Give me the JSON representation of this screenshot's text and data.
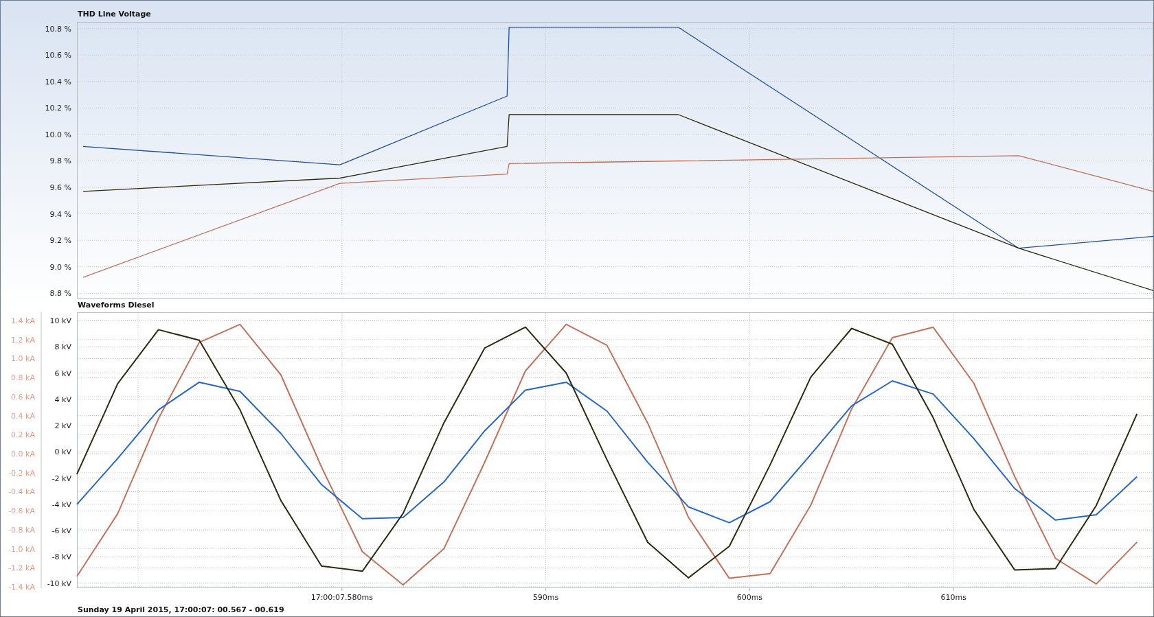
{
  "charts": [
    {
      "chart_data": {
        "type": "line",
        "title": "THD Line Voltage",
        "x": [
          567.3,
          579.9,
          588.1,
          588.2,
          596.5,
          613.2,
          619.8
        ],
        "xlim": [
          567,
          619.8
        ],
        "ylim": [
          8.76,
          10.85
        ],
        "grid": true,
        "yticks": [
          {
            "value": 10.8,
            "label": "10.8 %"
          },
          {
            "value": 10.6,
            "label": "10.6 %"
          },
          {
            "value": 10.4,
            "label": "10.4 %"
          },
          {
            "value": 10.2,
            "label": "10.2 %"
          },
          {
            "value": 10.0,
            "label": "10.0 %"
          },
          {
            "value": 9.8,
            "label": "9.8 %"
          },
          {
            "value": 9.6,
            "label": "9.6 %"
          },
          {
            "value": 9.4,
            "label": "9.4 %"
          },
          {
            "value": 9.2,
            "label": "9.2 %"
          },
          {
            "value": 9.0,
            "label": "9.0 %"
          },
          {
            "value": 8.8,
            "label": "8.8 %"
          }
        ],
        "series": [
          {
            "color": "#1f4ea3",
            "values": [
              9.91,
              9.77,
              10.29,
              10.81,
              10.81,
              9.14,
              9.23
            ]
          },
          {
            "color": "#2b2a0c",
            "values": [
              9.57,
              9.67,
              9.91,
              10.15,
              10.15,
              9.14,
              8.82
            ]
          },
          {
            "color": "#bf6f58",
            "values": [
              8.92,
              9.63,
              9.7,
              9.78,
              9.8,
              9.84,
              9.57
            ]
          }
        ]
      }
    },
    {
      "chart_data": {
        "type": "line",
        "title": "Waveforms Diesel",
        "x": [
          567,
          569,
          571,
          573,
          575,
          577,
          579,
          581,
          583,
          585,
          587,
          589,
          591,
          593,
          595,
          597,
          599,
          601,
          603,
          605,
          607,
          609,
          611,
          613,
          615,
          617,
          619
        ],
        "xlim": [
          567,
          619.8
        ],
        "ylim": [
          -10.39,
          10.63
        ],
        "grid": true,
        "y2lim": [
          -1.414,
          1.487
        ],
        "xticks": [
          {
            "value": 580,
            "label": "17:00:07.580ms"
          },
          {
            "value": 590,
            "label": "590ms"
          },
          {
            "value": 600,
            "label": "600ms"
          },
          {
            "value": 610,
            "label": "610ms"
          }
        ],
        "yticks": [
          {
            "value": 10,
            "label": "10 kV"
          },
          {
            "value": 8,
            "label": "8 kV"
          },
          {
            "value": 6,
            "label": "6 kV"
          },
          {
            "value": 4,
            "label": "4 kV"
          },
          {
            "value": 2,
            "label": "2 kV"
          },
          {
            "value": 0,
            "label": "0 kV"
          },
          {
            "value": -2,
            "label": "-2 kV"
          },
          {
            "value": -4,
            "label": "-4 kV"
          },
          {
            "value": -6,
            "label": "-6 kV"
          },
          {
            "value": -8,
            "label": "-8 kV"
          },
          {
            "value": -10,
            "label": "-10 kV"
          }
        ],
        "y2ticks": [
          {
            "value": 1.4,
            "label": "1.4 kA"
          },
          {
            "value": 1.2,
            "label": "1.2 kA"
          },
          {
            "value": 1.0,
            "label": "1.0 kA"
          },
          {
            "value": 0.8,
            "label": "0.8 kA"
          },
          {
            "value": 0.6,
            "label": "0.6 kA"
          },
          {
            "value": 0.4,
            "label": "0.4 kA"
          },
          {
            "value": 0.2,
            "label": "0.2 kA"
          },
          {
            "value": 0.0,
            "label": "0.0 kA"
          },
          {
            "value": -0.2,
            "label": "-0.2 kA"
          },
          {
            "value": -0.4,
            "label": "-0.4 kA"
          },
          {
            "value": -0.6,
            "label": "-0.6 kA"
          },
          {
            "value": -0.8,
            "label": "-0.8 kA"
          },
          {
            "value": -1.0,
            "label": "-1.0 kA"
          },
          {
            "value": -1.2,
            "label": "-1.2 kA"
          },
          {
            "value": -1.4,
            "label": "-1.4 kA"
          }
        ],
        "series": [
          {
            "color": "#c4705a",
            "axis": "y2",
            "values": [
              -1.29,
              -0.63,
              0.37,
              1.17,
              1.36,
              0.83,
              -0.14,
              -1.03,
              -1.38,
              -1.0,
              -0.09,
              0.87,
              1.36,
              1.14,
              0.32,
              -0.67,
              -1.31,
              -1.26,
              -0.54,
              0.47,
              1.22,
              1.33,
              0.74,
              -0.24,
              -1.1,
              -1.37,
              -0.93
            ]
          },
          {
            "color": "#2466cc",
            "values": [
              -4.0,
              -0.5,
              3.2,
              5.3,
              4.6,
              1.4,
              -2.5,
              -5.1,
              -5.0,
              -2.3,
              1.6,
              4.7,
              5.3,
              3.1,
              -0.8,
              -4.2,
              -5.4,
              -3.8,
              -0.2,
              3.5,
              5.4,
              4.4,
              1.0,
              -2.8,
              -5.2,
              -4.8,
              -1.9
            ]
          },
          {
            "color": "#2b2a0c",
            "values": [
              -1.7,
              5.2,
              9.3,
              8.5,
              3.2,
              -3.7,
              -8.7,
              -9.1,
              -4.7,
              2.2,
              7.9,
              9.5,
              6.0,
              -0.6,
              -6.9,
              -9.6,
              -7.2,
              -1.0,
              5.7,
              9.4,
              8.2,
              2.6,
              -4.4,
              -9.0,
              -8.9,
              -4.1,
              2.9
            ]
          }
        ]
      }
    }
  ],
  "footer": "Sunday 19 April 2015, 17:00:07: 00.567 - 00.619"
}
